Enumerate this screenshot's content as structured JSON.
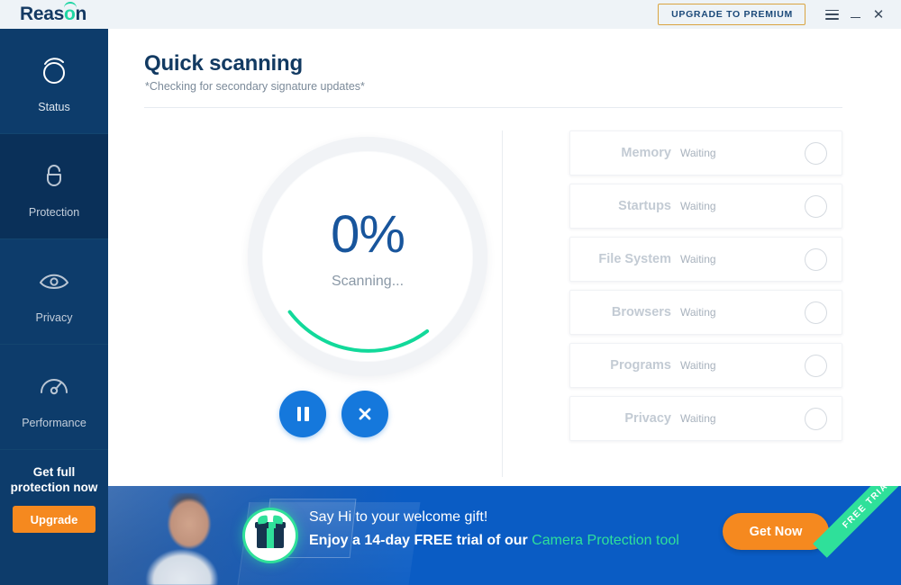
{
  "titlebar": {
    "logo_text": "Reas",
    "logo_accent": "o",
    "logo_tail": "n",
    "upgrade_button": "UPGRADE TO PREMIUM",
    "menu_icon": "hamburger-icon",
    "minimize_icon": "minimize-icon",
    "close_icon": "close-icon"
  },
  "sidebar": {
    "items": [
      {
        "label": "Status",
        "icon": "status-logo-icon",
        "active": true
      },
      {
        "label": "Protection",
        "icon": "unlock-icon",
        "active": false
      },
      {
        "label": "Privacy",
        "icon": "eye-icon",
        "active": false
      },
      {
        "label": "Performance",
        "icon": "gauge-icon",
        "active": false
      }
    ],
    "promo": {
      "title": "Get full protection now",
      "button": "Upgrade"
    }
  },
  "main": {
    "title": "Quick scanning",
    "subtitle": "*Checking for secondary signature updates*",
    "progress": {
      "percent_label": "0%",
      "percent_value": 0,
      "state_label": "Scanning...",
      "arc_color": "#12d99a",
      "track_color": "#f1f3f6"
    },
    "actions": [
      {
        "name": "pause-scan-button",
        "icon": "pause-icon"
      },
      {
        "name": "stop-scan-button",
        "icon": "close-icon"
      }
    ],
    "scan_items": [
      {
        "name": "Memory",
        "status": "Waiting"
      },
      {
        "name": "Startups",
        "status": "Waiting"
      },
      {
        "name": "File System",
        "status": "Waiting"
      },
      {
        "name": "Browsers",
        "status": "Waiting"
      },
      {
        "name": "Programs",
        "status": "Waiting"
      },
      {
        "name": "Privacy",
        "status": "Waiting"
      }
    ]
  },
  "banner": {
    "line1": "Say Hi to your welcome gift!",
    "line2_prefix": "Enjoy a 14-day FREE trial of our ",
    "line2_highlight": "Camera Protection tool",
    "cta_label": "Get Now",
    "ribbon_label": "FREE TRIAL",
    "gift_icon": "gift-icon"
  },
  "colors": {
    "brand_navy": "#0d3c6b",
    "accent_green": "#2fe09a",
    "accent_orange": "#f5891f",
    "accent_blue": "#1578dc",
    "banner_blue": "#0a5cc4",
    "premium_gold": "#d9a441"
  }
}
